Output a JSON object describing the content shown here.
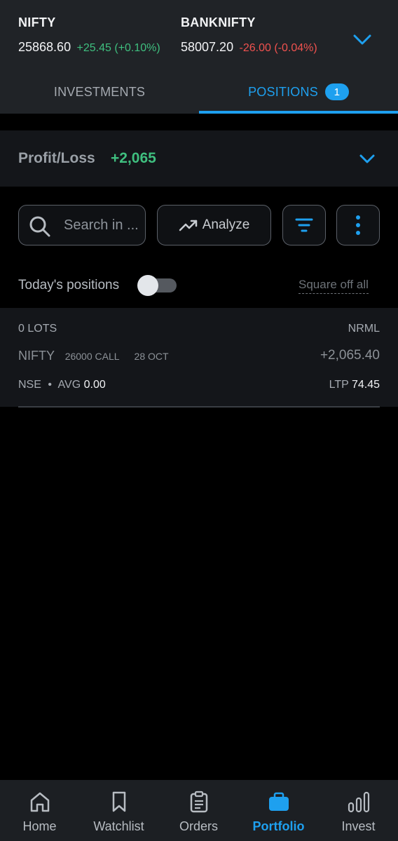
{
  "indices": [
    {
      "name": "NIFTY",
      "value": "25868.60",
      "change": "+25.45 (+0.10%)",
      "direction": "up"
    },
    {
      "name": "BANKNIFTY",
      "value": "58007.20",
      "change": "-26.00 (-0.04%)",
      "direction": "down"
    }
  ],
  "tabs": {
    "investments": "INVESTMENTS",
    "positions": "POSITIONS",
    "positions_count": "1",
    "active": "positions"
  },
  "profit_loss": {
    "label": "Profit/Loss",
    "value": "+2,065"
  },
  "toolbar": {
    "search_placeholder": "Search in ...",
    "analyze_label": "Analyze"
  },
  "today": {
    "label": "Today's positions",
    "toggle_on": false,
    "square_off": "Square off all"
  },
  "positions": [
    {
      "lots": "0 LOTS",
      "product": "NRML",
      "symbol": "NIFTY",
      "strike": "26000 CALL",
      "expiry": "28 OCT",
      "pnl": "+2,065.40",
      "exchange": "NSE",
      "avg_label": "AVG",
      "avg": "0.00",
      "ltp_label": "LTP",
      "ltp": "74.45"
    }
  ],
  "bottom_nav": [
    {
      "label": "Home",
      "icon": "home-icon"
    },
    {
      "label": "Watchlist",
      "icon": "bookmark-icon"
    },
    {
      "label": "Orders",
      "icon": "clipboard-icon"
    },
    {
      "label": "Portfolio",
      "icon": "briefcase-icon",
      "active": true
    },
    {
      "label": "Invest",
      "icon": "bar-chart-icon"
    }
  ],
  "colors": {
    "accent": "#1ea0ef",
    "positive": "#3fbf7f",
    "negative": "#f0524f",
    "background": "#000000"
  }
}
